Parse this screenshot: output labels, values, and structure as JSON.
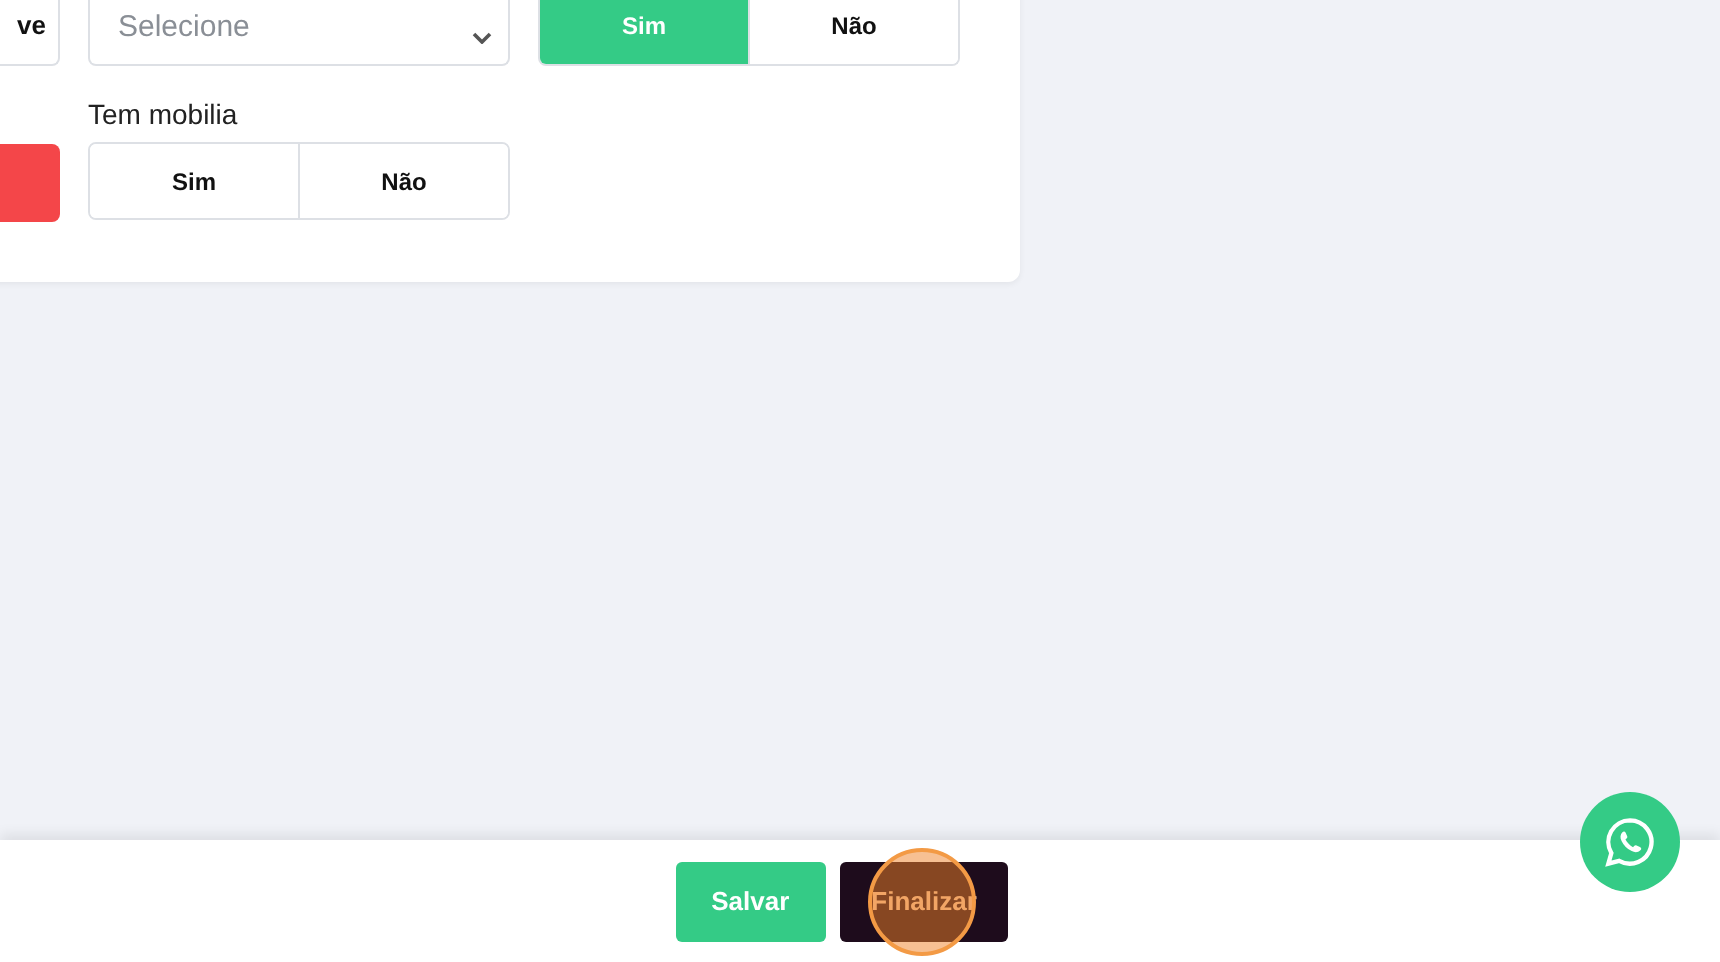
{
  "form": {
    "left_column": {
      "button_1": "ve"
    },
    "select": {
      "placeholder": "Selecione"
    },
    "toggles": [
      {
        "options": [
          {
            "label": "Sim",
            "selected": true
          },
          {
            "label": "Não",
            "selected": false
          }
        ]
      },
      {
        "label": "Tem mobilia",
        "options": [
          {
            "label": "Sim",
            "selected": false
          },
          {
            "label": "Não",
            "selected": false
          }
        ]
      }
    ]
  },
  "footer": {
    "buttons": [
      {
        "label": "Salvar",
        "kind": "save"
      },
      {
        "label": "Finalizar",
        "kind": "finish"
      }
    ]
  }
}
